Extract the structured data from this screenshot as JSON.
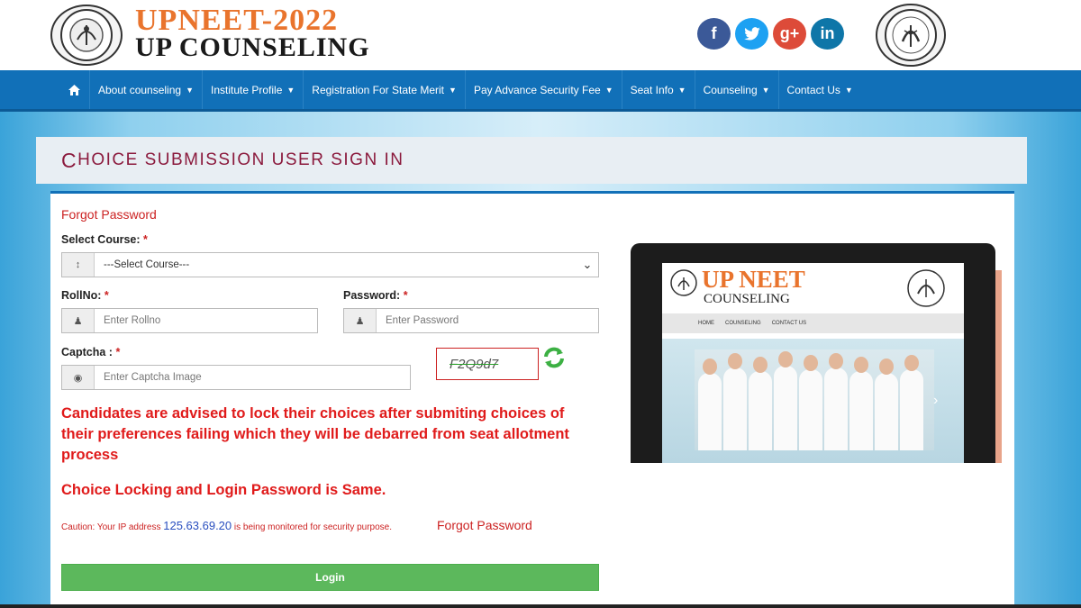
{
  "header": {
    "title": "UPNEET-2022",
    "subtitle": "UP COUNSELING",
    "left_logo": "up-govt-seal-icon",
    "right_logo": "up-govt-emblem-icon",
    "socials": [
      {
        "name": "facebook-icon",
        "glyph": "f",
        "color": "#3b5998"
      },
      {
        "name": "twitter-icon",
        "glyph": "t",
        "color": "#1da1f2"
      },
      {
        "name": "google-plus-icon",
        "glyph": "g+",
        "color": "#dd4b39"
      },
      {
        "name": "linkedin-icon",
        "glyph": "in",
        "color": "#0e76a8"
      }
    ]
  },
  "nav": {
    "home_icon": "home-icon",
    "items": [
      {
        "label": "About counseling",
        "id": "about"
      },
      {
        "label": "Institute Profile",
        "id": "institute"
      },
      {
        "label": "Registration For State Merit",
        "id": "registration"
      },
      {
        "label": "Pay Advance Security Fee",
        "id": "pay-fee"
      },
      {
        "label": "Seat Info",
        "id": "seat-info"
      },
      {
        "label": "Counseling",
        "id": "counseling"
      },
      {
        "label": "Contact Us",
        "id": "contact"
      }
    ]
  },
  "page": {
    "title_first": "C",
    "title_rest": "HOICE SUBMISSION USER SIGN IN"
  },
  "form": {
    "forgot_top": "Forgot Password",
    "course_label": "Select Course:",
    "course_value": "---Select Course---",
    "rollno_label": "RollNo:",
    "rollno_placeholder": "Enter Rollno",
    "password_label": "Password:",
    "password_placeholder": "Enter Password",
    "captcha_label": "Captcha :",
    "captcha_placeholder": "Enter Captcha Image",
    "captcha_text": "F2Q9d7",
    "required_mark": "*",
    "notice": "Candidates are advised to lock their choices after submiting choices of their preferences failing which they will be debarred from seat allotment process",
    "notice2": "Choice Locking and Login Password is Same.",
    "caution_prefix": "Caution: Your IP address",
    "ip": "125.63.69.20",
    "caution_suffix": "is being monitored for security purpose.",
    "forgot_bottom": "Forgot Password",
    "login_label": "Login"
  },
  "illustration": {
    "title": "UP NEET",
    "subtitle": "COUNSELING",
    "nav": [
      "HOME",
      "COUNSELING",
      "CONTACT US"
    ]
  },
  "colors": {
    "brand_orange": "#e9742d",
    "nav_blue": "#1170b8",
    "title_maroon": "#8b1a3d",
    "alert_red": "#e01b1b",
    "login_green": "#5cb85c"
  }
}
